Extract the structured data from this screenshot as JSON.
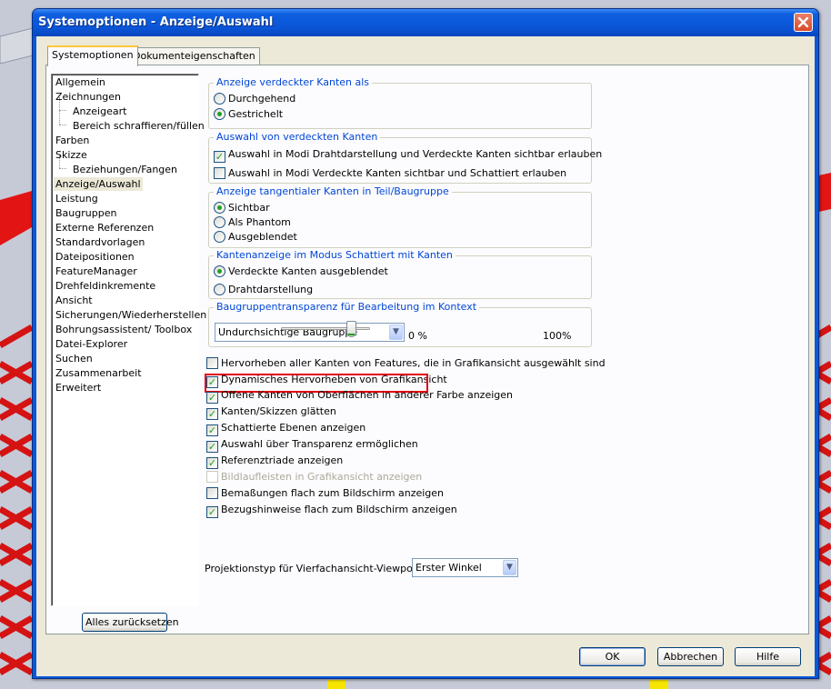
{
  "window": {
    "title": "Systemoptionen - Anzeige/Auswahl"
  },
  "tabs": [
    {
      "label": "Systemoptionen",
      "active": true
    },
    {
      "label": "Dokumenteigenschaften",
      "active": false
    }
  ],
  "tree": {
    "items": [
      {
        "label": "Allgemein",
        "level": 0
      },
      {
        "label": "Zeichnungen",
        "level": 0
      },
      {
        "label": "Anzeigeart",
        "level": 1
      },
      {
        "label": "Bereich schraffieren/füllen",
        "level": 1
      },
      {
        "label": "Farben",
        "level": 0
      },
      {
        "label": "Skizze",
        "level": 0
      },
      {
        "label": "Beziehungen/Fangen",
        "level": 1
      },
      {
        "label": "Anzeige/Auswahl",
        "level": 0,
        "selected": true
      },
      {
        "label": "Leistung",
        "level": 0
      },
      {
        "label": "Baugruppen",
        "level": 0
      },
      {
        "label": "Externe Referenzen",
        "level": 0
      },
      {
        "label": "Standardvorlagen",
        "level": 0
      },
      {
        "label": "Dateipositionen",
        "level": 0
      },
      {
        "label": "FeatureManager",
        "level": 0
      },
      {
        "label": "Drehfeldinkremente",
        "level": 0
      },
      {
        "label": "Ansicht",
        "level": 0
      },
      {
        "label": "Sicherungen/Wiederherstellen",
        "level": 0
      },
      {
        "label": "Bohrungsassistent/ Toolbox",
        "level": 0
      },
      {
        "label": "Datei-Explorer",
        "level": 0
      },
      {
        "label": "Suchen",
        "level": 0
      },
      {
        "label": "Zusammenarbeit",
        "level": 0
      },
      {
        "label": "Erweitert",
        "level": 0
      }
    ],
    "reset_label": "Alles zurücksetzen"
  },
  "groups": {
    "hidden_edges": {
      "title": "Anzeige verdeckter Kanten als",
      "options": [
        {
          "label": "Durchgehend",
          "selected": false
        },
        {
          "label": "Gestrichelt",
          "selected": true
        }
      ]
    },
    "select_hidden": {
      "title": "Auswahl von verdeckten Kanten",
      "options": [
        {
          "label": "Auswahl in Modi Drahtdarstellung und Verdeckte Kanten sichtbar erlauben",
          "checked": true
        },
        {
          "label": "Auswahl in Modi Verdeckte Kanten sichtbar und Schattiert erlauben",
          "checked": false
        }
      ]
    },
    "tangent_edges": {
      "title": "Anzeige tangentialer Kanten in Teil/Baugruppe",
      "options": [
        {
          "label": "Sichtbar",
          "selected": true
        },
        {
          "label": "Als Phantom",
          "selected": false
        },
        {
          "label": "Ausgeblendet",
          "selected": false
        }
      ]
    },
    "shaded_edges": {
      "title": "Kantenanzeige im Modus Schattiert mit Kanten",
      "options": [
        {
          "label": "Verdeckte Kanten ausgeblendet",
          "selected": true
        },
        {
          "label": "Drahtdarstellung",
          "selected": false
        }
      ]
    },
    "transparency": {
      "title": "Baugruppentransparenz für Bearbeitung im Kontext",
      "combo_value": "Undurchsichtige Baugruppe",
      "min_label": "0 %",
      "max_label": "100%",
      "slider_value_percent": 90
    }
  },
  "checkboxes": [
    {
      "label": "Hervorheben aller Kanten von Features, die in Grafikansicht ausgewählt sind",
      "checked": false,
      "enabled": true
    },
    {
      "label": "Dynamisches Hervorheben von Grafikansicht",
      "checked": true,
      "enabled": true,
      "highlighted": true
    },
    {
      "label": "Offene Kanten von Oberflächen in anderer Farbe anzeigen",
      "checked": true,
      "enabled": true
    },
    {
      "label": "Kanten/Skizzen glätten",
      "checked": true,
      "enabled": true
    },
    {
      "label": "Schattierte Ebenen anzeigen",
      "checked": true,
      "enabled": true
    },
    {
      "label": "Auswahl über Transparenz ermöglichen",
      "checked": true,
      "enabled": true
    },
    {
      "label": "Referenztriade anzeigen",
      "checked": true,
      "enabled": true
    },
    {
      "label": "Bildlaufleisten in Grafikansicht anzeigen",
      "checked": false,
      "enabled": false
    },
    {
      "label": "Bemaßungen flach zum Bildschirm anzeigen",
      "checked": false,
      "enabled": true
    },
    {
      "label": "Bezugshinweise flach zum Bildschirm anzeigen",
      "checked": true,
      "enabled": true
    }
  ],
  "projection": {
    "label": "Projektionstyp für Vierfachansicht-Viewport:",
    "value": "Erster Winkel"
  },
  "buttons": {
    "ok": "OK",
    "cancel": "Abbrechen",
    "help": "Hilfe"
  },
  "colors": {
    "highlight_border": "#e0000a",
    "group_title": "#0046d5",
    "titlebar": "#0a55d6"
  },
  "icons": {
    "close": "close-icon",
    "dropdown": "chevron-down-icon",
    "check": "checkmark-icon"
  }
}
